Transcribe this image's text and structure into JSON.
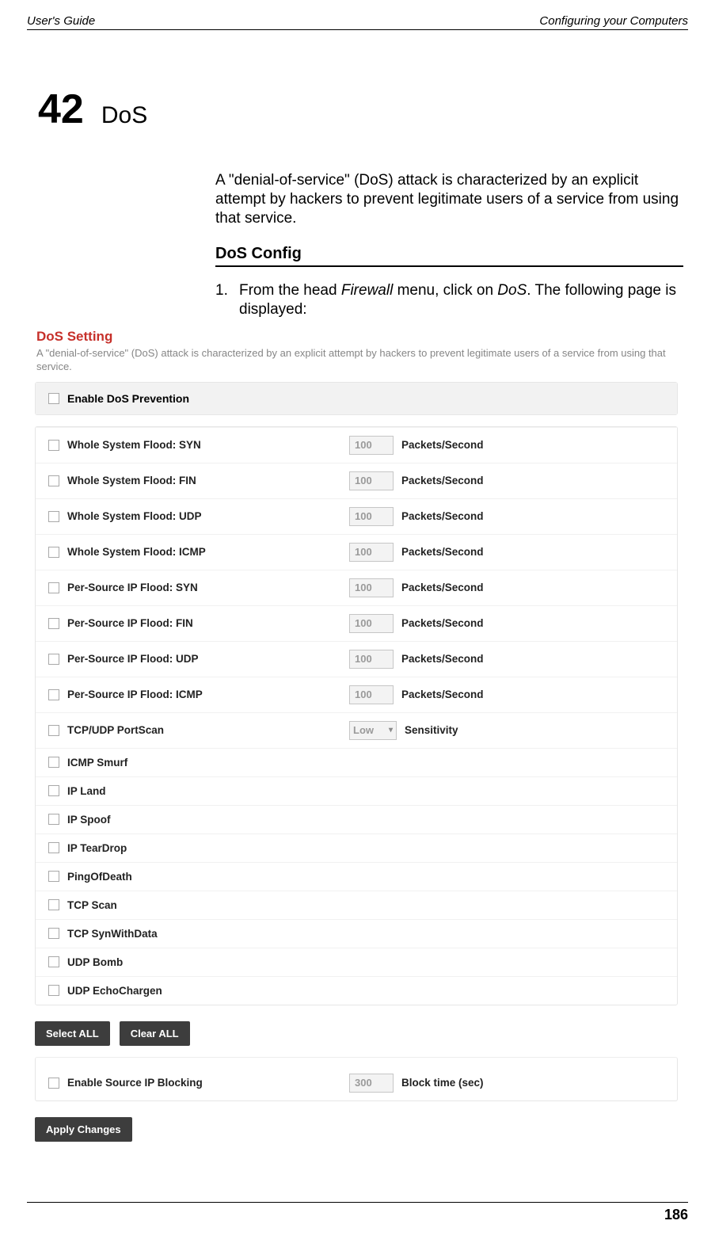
{
  "header": {
    "left": "User's Guide",
    "right": "Configuring your Computers"
  },
  "chapter": {
    "number": "42",
    "title": "DoS"
  },
  "intro": "A \"denial-of-service\" (DoS) attack is characterized by an explicit attempt by hackers to prevent legitimate users of a service from using that service.",
  "section_heading": "DoS Config",
  "step": {
    "num": "1.",
    "pre": "From the head ",
    "menu": "Firewall",
    "mid": " menu, click on ",
    "item": "DoS",
    "post": ". The following page is displayed:"
  },
  "screenshot": {
    "title": "DoS Setting",
    "desc": "A \"denial-of-service\" (DoS) attack is characterized by an explicit attempt by hackers to prevent legitimate users of a service from using that service.",
    "enable_label": "Enable DoS Prevention",
    "rows_rate": [
      {
        "label": "Whole System Flood: SYN",
        "value": "100",
        "unit": "Packets/Second"
      },
      {
        "label": "Whole System Flood: FIN",
        "value": "100",
        "unit": "Packets/Second"
      },
      {
        "label": "Whole System Flood: UDP",
        "value": "100",
        "unit": "Packets/Second"
      },
      {
        "label": "Whole System Flood: ICMP",
        "value": "100",
        "unit": "Packets/Second"
      },
      {
        "label": "Per-Source IP Flood: SYN",
        "value": "100",
        "unit": "Packets/Second"
      },
      {
        "label": "Per-Source IP Flood: FIN",
        "value": "100",
        "unit": "Packets/Second"
      },
      {
        "label": "Per-Source IP Flood: UDP",
        "value": "100",
        "unit": "Packets/Second"
      },
      {
        "label": "Per-Source IP Flood: ICMP",
        "value": "100",
        "unit": "Packets/Second"
      }
    ],
    "portscan": {
      "label": "TCP/UDP PortScan",
      "value": "Low",
      "unit": "Sensitivity"
    },
    "rows_simple": [
      "ICMP Smurf",
      "IP Land",
      "IP Spoof",
      "IP TearDrop",
      "PingOfDeath",
      "TCP Scan",
      "TCP SynWithData",
      "UDP Bomb",
      "UDP EchoChargen"
    ],
    "buttons": {
      "select_all": "Select ALL",
      "clear_all": "Clear ALL"
    },
    "ipblock": {
      "label": "Enable Source IP Blocking",
      "value": "300",
      "unit": "Block time (sec)"
    },
    "apply": "Apply Changes"
  },
  "page_number": "186"
}
